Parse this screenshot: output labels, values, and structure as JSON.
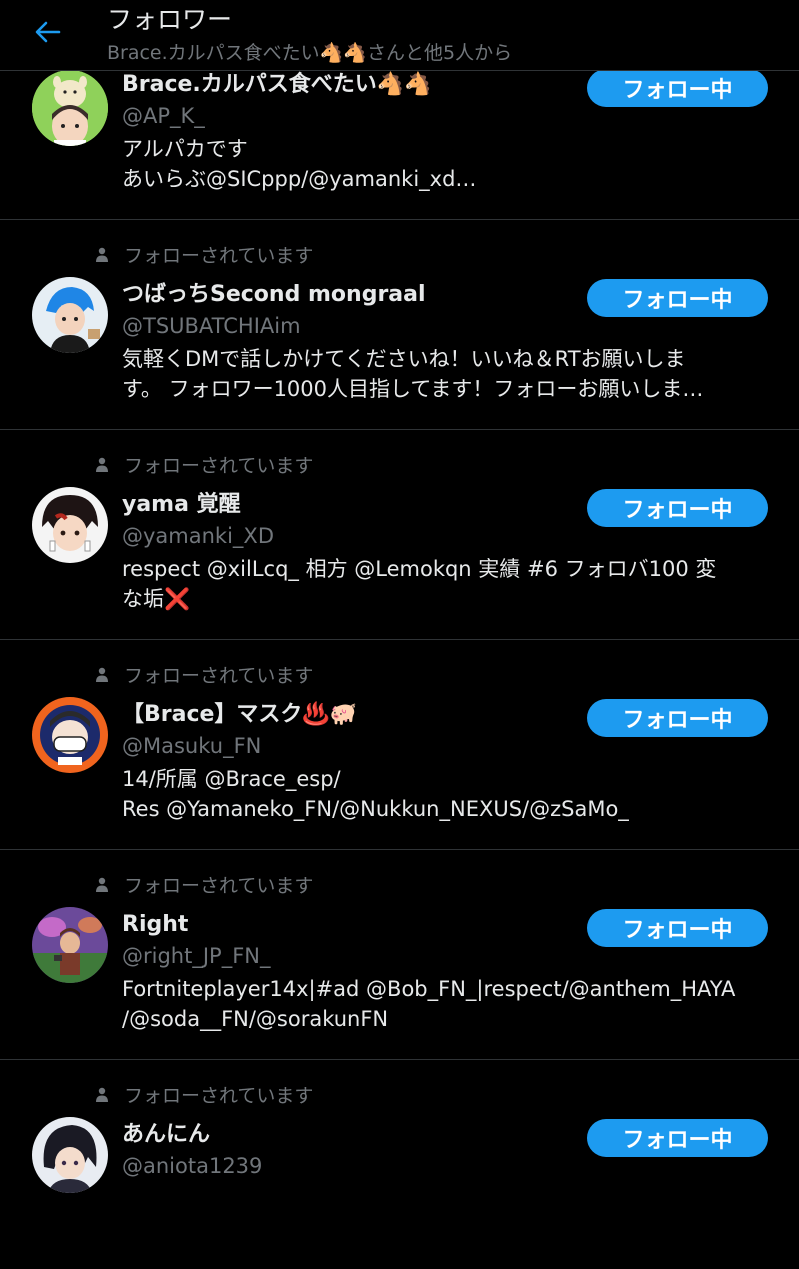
{
  "header": {
    "title": "フォロワー",
    "subtitle": "Brace.カルパス食べたい🐴🐴さんと他5人から",
    "back_icon": "arrow-left-icon"
  },
  "colors": {
    "background": "#000000",
    "accent": "#1d9bf0",
    "secondary_text": "#71767b",
    "divider": "#2f3336"
  },
  "followers": [
    {
      "name": "Brace.カルパス食べたい🐴🐴",
      "handle": "@AP_K_",
      "bio": "アルパカです\nあいらぶ@SICppp/@yamanki_xd…",
      "follows_you": "",
      "button": "フォロー中"
    },
    {
      "name": "つばっちSecond mongraal",
      "handle": "@TSUBATCHIAim",
      "bio": "気軽くDMで話しかけてくださいね！いいね＆RTお願いしま\nす。 フォロワー1000人目指してます！フォローお願いしま…",
      "follows_you": "フォローされています",
      "button": "フォロー中"
    },
    {
      "name": "yama 覚醒",
      "handle": "@yamanki_XD",
      "bio": "respect @xilLcq_ 相方 @Lemokqn 実績 #6 フォロバ100 変\nな垢❌",
      "follows_you": "フォローされています",
      "button": "フォロー中"
    },
    {
      "name": "【Brace】マスク♨️🐖",
      "handle": "@Masuku_FN",
      "bio": "14/所属 @Brace_esp/\nRes @Yamaneko_FN/@Nukkun_NEXUS/@zSaMo_",
      "follows_you": "フォローされています",
      "button": "フォロー中"
    },
    {
      "name": "Right",
      "handle": "@right_JP_FN_",
      "bio": "Fortniteplayer14x|#ad @Bob_FN_|respect/@anthem_HAYA\n/@soda__FN/@sorakunFN",
      "follows_you": "フォローされています",
      "button": "フォロー中"
    },
    {
      "name": "あんにん",
      "handle": "@aniota1239",
      "bio": "",
      "follows_you": "フォローされています",
      "button": "フォロー中"
    }
  ]
}
